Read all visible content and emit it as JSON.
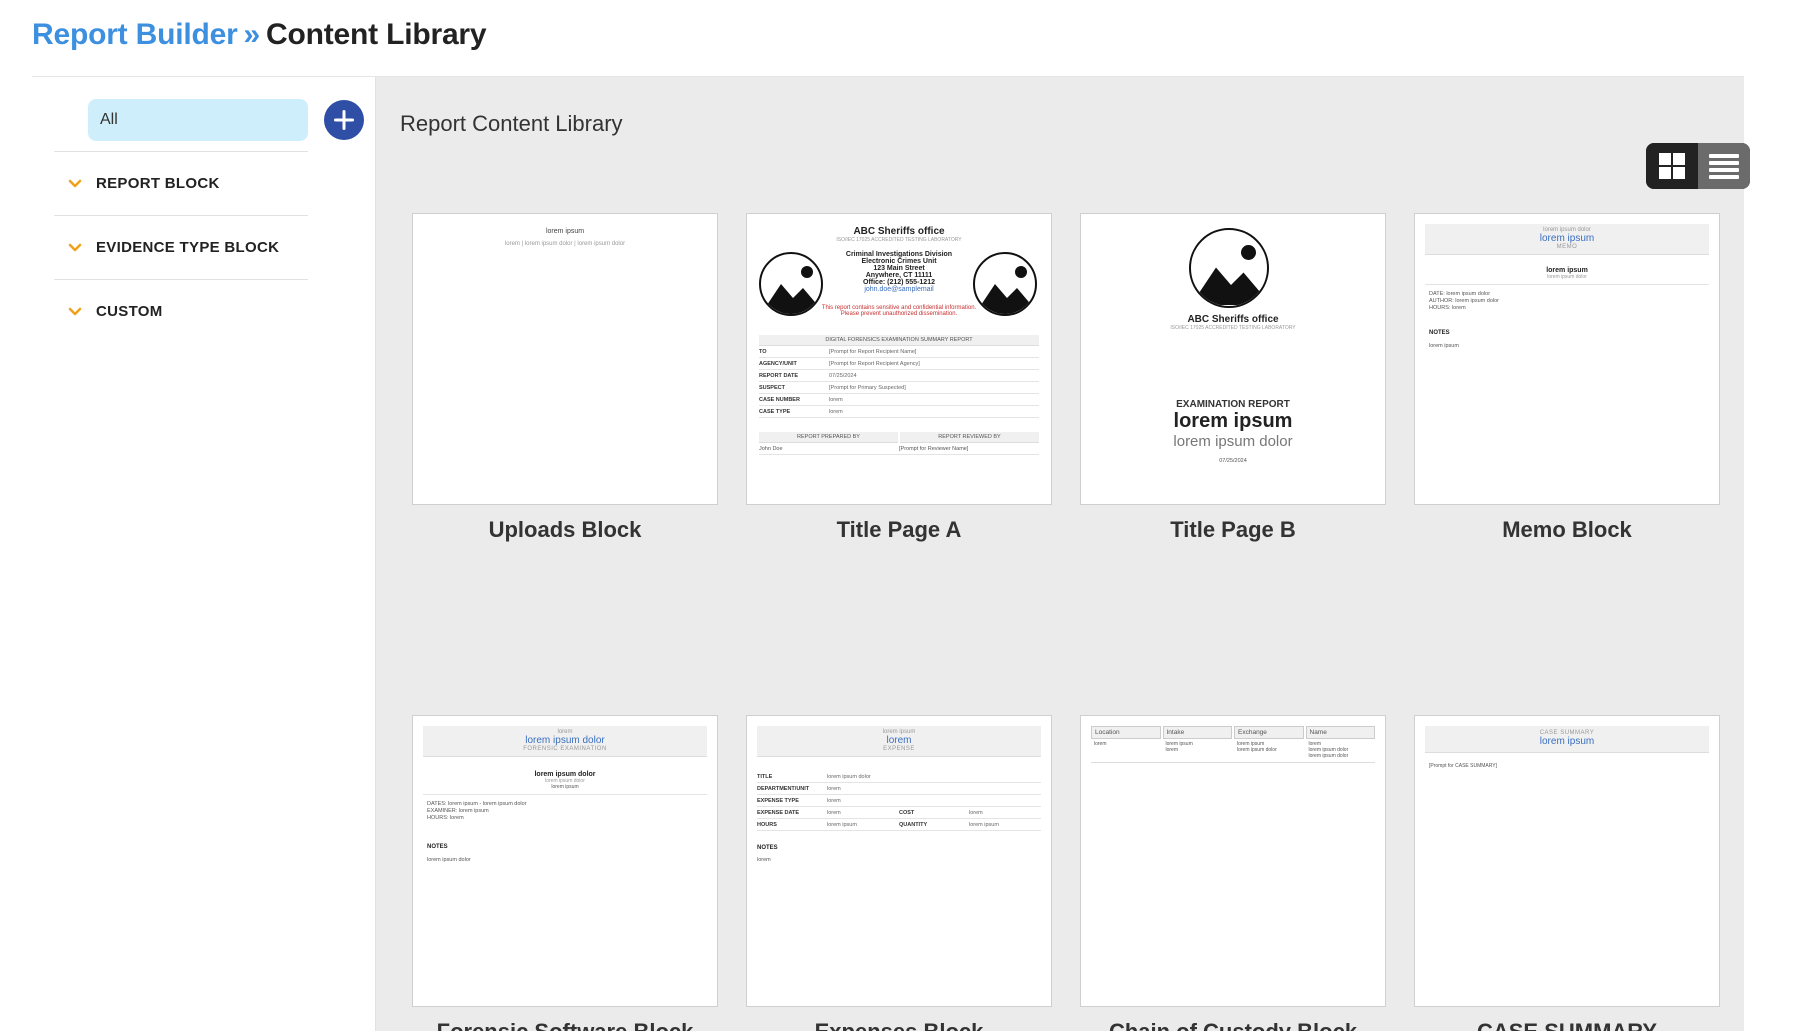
{
  "breadcrumb": {
    "root": "Report Builder",
    "separator": "»",
    "current": "Content Library"
  },
  "sidebar": {
    "filter_all": "All",
    "categories": [
      {
        "label": "REPORT BLOCK"
      },
      {
        "label": "EVIDENCE TYPE BLOCK"
      },
      {
        "label": "CUSTOM"
      }
    ]
  },
  "main": {
    "title": "Report Content Library"
  },
  "colors": {
    "accent": "#3d8fe0",
    "add_button": "#2f4ea6",
    "filter_active": "#cfeefc",
    "chevron": "#f0a21e",
    "main_bg": "#ebebeb"
  },
  "cards": [
    {
      "label": "Uploads Block",
      "preview": {
        "title": "lorem ipsum",
        "line": "lorem  |  lorem ipsum dolor  |  lorem ipsum dolor"
      }
    },
    {
      "label": "Title Page A",
      "preview": {
        "org": "ABC Sheriffs office",
        "accred": "ISO/IEC 17025 ACCREDITED TESTING LABORATORY",
        "division": "Criminal Investigations Division",
        "unit": "Electronic Crimes Unit",
        "street": "123 Main Street",
        "city": "Anywhere, CT 11111",
        "office": "Office: (212) 555-1212",
        "email": "john.doe@samplemail",
        "warning1": "This report contains sensitive and confidential information.",
        "warning2": "Please prevent unauthorized dissemination.",
        "section": "DIGITAL FORENSICS EXAMINATION SUMMARY REPORT",
        "rows": [
          {
            "k": "TO",
            "v": "[Prompt for Report Recipient Name]"
          },
          {
            "k": "AGENCY/UNIT",
            "v": "[Prompt for Report Recipient Agency]"
          },
          {
            "k": "REPORT DATE",
            "v": "07/25/2024"
          },
          {
            "k": "SUSPECT",
            "v": "[Prompt for Primary Suspected]"
          },
          {
            "k": "CASE NUMBER",
            "v": "lorem"
          },
          {
            "k": "CASE TYPE",
            "v": "lorem"
          }
        ],
        "prepared": "REPORT PREPARED BY",
        "reviewed": "REPORT REVIEWED BY",
        "preparer": "John Doe",
        "reviewer": "[Prompt for Reviewer Name]"
      }
    },
    {
      "label": "Title Page B",
      "preview": {
        "org": "ABC Sheriffs office",
        "accred": "ISO/IEC 17025 ACCREDITED TESTING LABORATORY",
        "heading": "EXAMINATION REPORT",
        "big": "lorem ipsum",
        "sub": "lorem ipsum dolor",
        "date": "07/25/2024"
      }
    },
    {
      "label": "Memo Block",
      "preview": {
        "top": "lorem ipsum dolor",
        "title": "lorem ipsum",
        "kind": "MEMO",
        "name": "lorem ipsum",
        "sub": "lorem ipsum dolor",
        "date": "DATE:  lorem ipsum dolor",
        "author": "AUTHOR:  lorem ipsum dolor",
        "hours": "HOURS:  lorem",
        "notes": "NOTES",
        "notes_text": "lorem ipsum"
      }
    },
    {
      "label": "Forensic Software Block",
      "preview": {
        "top": "lorem",
        "title": "lorem ipsum dolor",
        "kind": "FORENSIC EXAMINATION",
        "name": "lorem ipsum dolor",
        "sub1": "lorem ipsum dolor",
        "sub2": "lorem ipsum",
        "dates": "DATES:  lorem ipsum - lorem ipsum dolor",
        "examiner": "EXAMINER:  lorem ipsum",
        "hours": "HOURS:  lorem",
        "notes": "NOTES",
        "notes_text": "lorem ipsum dolor"
      }
    },
    {
      "label": "Expenses Block",
      "preview": {
        "top": "lorem ipsum",
        "title": "lorem",
        "kind": "EXPENSE",
        "rows": [
          {
            "k": "TITLE",
            "v": "lorem ipsum dolor"
          },
          {
            "k": "DEPARTMENT/UNIT",
            "v": "lorem"
          },
          {
            "k": "EXPENSE TYPE",
            "v": "lorem"
          }
        ],
        "date_k": "EXPENSE DATE",
        "date_v": "lorem",
        "cost_k": "COST",
        "cost_v": "lorem",
        "hours_k": "HOURS",
        "hours_v": "lorem ipsum",
        "qty_k": "QUANTITY",
        "qty_v": "lorem ipsum",
        "notes": "NOTES",
        "notes_text": "lorem"
      }
    },
    {
      "label": "Chain of Custody Block",
      "preview": {
        "headers": [
          "Location",
          "Intake",
          "Exchange",
          "Name"
        ],
        "cells": [
          "lorem",
          "lorem ipsum\nlorem",
          "lorem ipsum\nlorem ipsum dolor",
          "lorem\nlorem ipsum dolor\nlorem ipsum dolor"
        ]
      }
    },
    {
      "label": "CASE SUMMARY",
      "preview": {
        "kind": "CASE SUMMARY",
        "title": "lorem ipsum",
        "prompt": "[Prompt for CASE SUMMARY]"
      }
    }
  ]
}
